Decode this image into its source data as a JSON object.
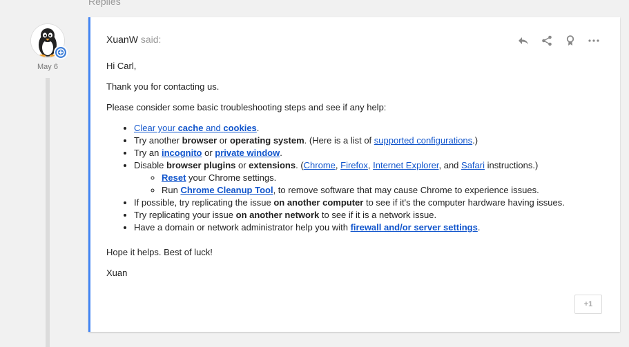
{
  "header": {
    "replies_label": "Replies"
  },
  "post": {
    "date": "May 6",
    "author": "XuanW",
    "said": "said:",
    "greeting": "Hi Carl,",
    "thanks": "Thank you for contacting us.",
    "intro": "Please consider some basic troubleshooting steps and see if any help:",
    "item1": {
      "t1": "Clear your ",
      "b1": "cache",
      "t2": " and ",
      "b2": "cookies",
      "t3": "."
    },
    "item2": {
      "t1": "Try another ",
      "b1": "browser",
      "t2": " or ",
      "b2": "operating system",
      "t3": ". (Here is a list of ",
      "link": "supported configurations",
      "t4": ".)"
    },
    "item3": {
      "t1": "Try an ",
      "link1": "incognito",
      "t2": " or ",
      "link2": "private window",
      "t3": "."
    },
    "item4": {
      "t1": "Disable ",
      "b1": "browser plugins",
      "t2": " or ",
      "b2": "extensions",
      "t3": ". (",
      "link1": "Chrome",
      "t4": ", ",
      "link2": "Firefox",
      "t5": ", ",
      "link3": "Internet Explorer",
      "t6": ", and ",
      "link4": "Safari",
      "t7": " instructions.)"
    },
    "sub1": {
      "link": "Reset",
      "t1": " your Chrome settings."
    },
    "sub2": {
      "t1": "Run ",
      "link": "Chrome Cleanup Tool",
      "t2": ", to remove software that may cause Chrome to experience issues."
    },
    "item5": {
      "t1": "If possible, try replicating the issue ",
      "b1": "on another computer",
      "t2": " to see if it's the computer hardware having issues."
    },
    "item6": {
      "t1": "Try replicating your issue ",
      "b1": "on another network",
      "t2": " to see if it is a network issue."
    },
    "item7": {
      "t1": "Have a domain or network administrator help you with ",
      "link": "firewall and/or server settings",
      "t2": "."
    },
    "closing": "Hope it helps. Best of luck!",
    "signature": "Xuan",
    "plus_one": "+1"
  },
  "icons": {
    "reply": "reply-icon",
    "share": "share-icon",
    "award": "award-icon",
    "more": "more-icon",
    "avatar": "penguin-avatar",
    "badge": "plus-badge-icon"
  },
  "colors": {
    "accent": "#4285f4",
    "link": "#15c",
    "background": "#f1f1f1"
  }
}
